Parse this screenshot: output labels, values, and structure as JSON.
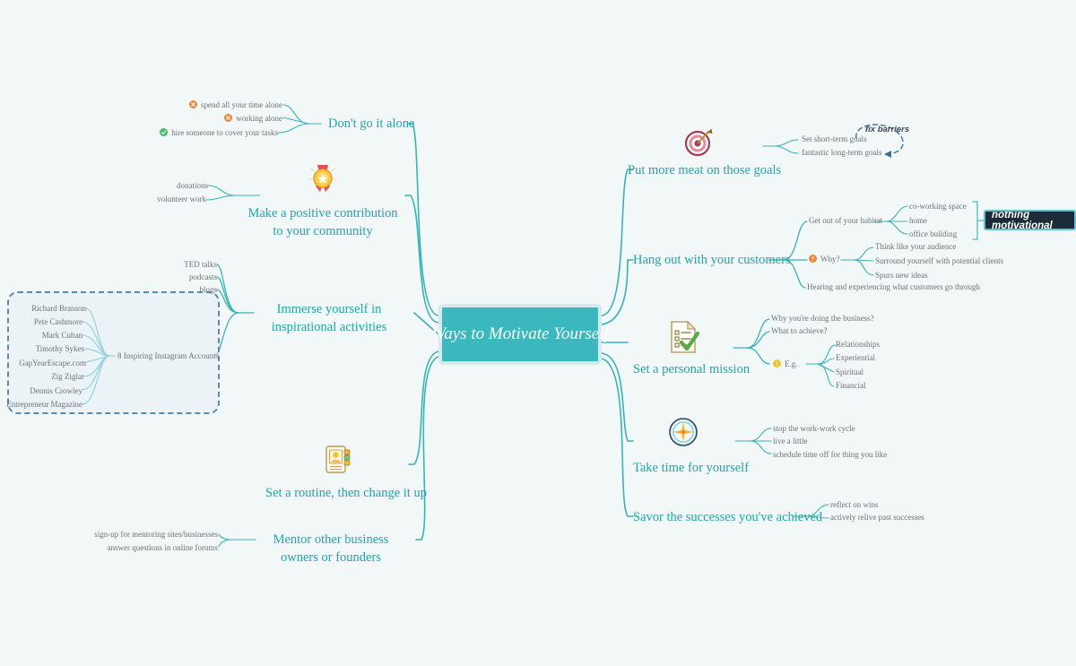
{
  "canvas": {
    "background": "#f2f7f8",
    "accent": "#21a5ab",
    "central_fill": "#3bb8bd",
    "sub_text_color": "#6d7276",
    "boundary_color": "#5a8ba6",
    "summary_fill": "#1d2b38"
  },
  "central": {
    "title": "Ways to Motivate Yourself"
  },
  "branches": {
    "dont_go_it_alone": {
      "label": "Don't go it alone",
      "children": [
        {
          "text": "spend all your time alone",
          "icon": "cross-circle-icon",
          "icon_color": "#ef8536"
        },
        {
          "text": "working alone",
          "icon": "cross-circle-icon",
          "icon_color": "#ef8536"
        },
        {
          "text": "hire someone to cover your tasks",
          "icon": "check-circle-icon",
          "icon_color": "#3fbf5f"
        }
      ]
    },
    "positive_contribution": {
      "label": "Make a positive contribution to your community",
      "icon": "medal-icon",
      "children": [
        {
          "text": "donations"
        },
        {
          "text": "volunteer work"
        }
      ]
    },
    "immerse_inspirational": {
      "label": "Immerse yourself in inspirational activities",
      "children": [
        {
          "text": "TED talks"
        },
        {
          "text": "podcasts"
        },
        {
          "text": "blogs"
        },
        {
          "text": "8 Inspiring Instagram Accounts"
        }
      ],
      "instagram_accounts": [
        "Richard Branson",
        "Pete Cashmore",
        "Mark Cuban",
        "Timothy Sykes",
        "GapYearEscape.com",
        "Zig Ziglar",
        "Dennis Crowley",
        "Entrepreneur Magazine"
      ]
    },
    "set_a_routine": {
      "label": "Set a routine, then change it up",
      "icon": "contact-card-icon"
    },
    "mentor_others": {
      "label": "Mentor other business owners or founders",
      "children": [
        {
          "text": "sign-up for mentoring sites/businesses"
        },
        {
          "text": "answer questions in online forums"
        }
      ]
    },
    "more_meat_goals": {
      "label": "Put more meat on those goals",
      "icon": "target-icon",
      "children": [
        {
          "text": "Set short-term goals"
        },
        {
          "text": "fantastic long-term goals"
        }
      ],
      "relationship_label": "fix barriers"
    },
    "hang_out_customers": {
      "label": "Hang out with your customers",
      "children": [
        {
          "text": "Get out of your habitat",
          "children": [
            {
              "text": "co-working space"
            },
            {
              "text": "home"
            },
            {
              "text": "office building"
            }
          ],
          "summary": "nothing motivational"
        },
        {
          "text": "Why?",
          "icon": "question-circle-icon",
          "icon_color": "#ef8536",
          "children": [
            {
              "text": "Think like your audience"
            },
            {
              "text": "Surround yourself with potential clients"
            },
            {
              "text": "Spurs new ideas"
            }
          ]
        },
        {
          "text": "Hearing and experiencing what customers go through"
        }
      ]
    },
    "personal_mission": {
      "label": "Set a personal mission",
      "icon": "checklist-doc-icon",
      "children": [
        {
          "text": "Why you're doing the business?"
        },
        {
          "text": "What to achieve?"
        },
        {
          "text": "E.g.",
          "icon": "exclaim-circle-icon",
          "icon_color": "#f0c330",
          "children": [
            {
              "text": "Relationships"
            },
            {
              "text": "Experiential"
            },
            {
              "text": "Spiritual"
            },
            {
              "text": "Financial"
            }
          ]
        }
      ]
    },
    "take_time": {
      "label": "Take time for yourself",
      "icon": "compass-clock-icon",
      "children": [
        {
          "text": "stop the work-work cycle"
        },
        {
          "text": "live a little"
        },
        {
          "text": "schedule time off for thing you like"
        }
      ]
    },
    "savor_successes": {
      "label": "Savor the successes you've achieved",
      "children": [
        {
          "text": "reflect on wins"
        },
        {
          "text": "actively relive past successes"
        }
      ]
    }
  }
}
